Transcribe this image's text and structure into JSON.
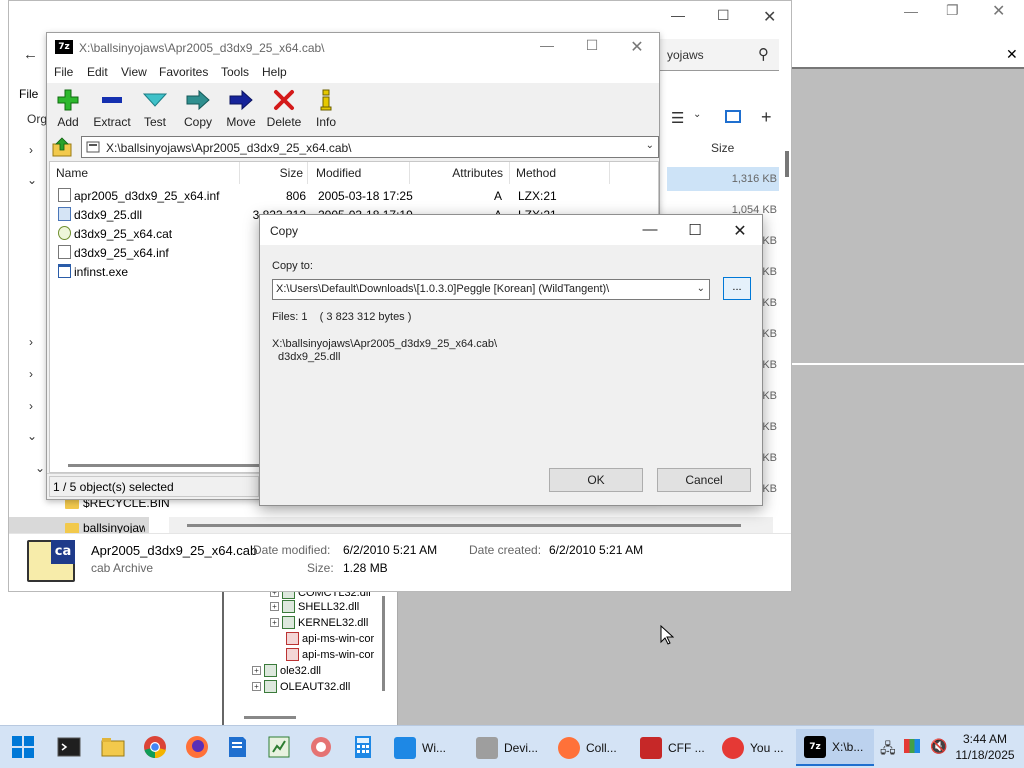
{
  "explorer": {
    "file_menu": "File",
    "org_label": "Org",
    "search_placeholder": "yojaws",
    "size_header": "Size",
    "sizes": [
      "1,316 KB",
      "1,054 KB",
      "KB",
      "KB",
      "KB",
      "KB",
      "KB",
      "KB",
      "KB",
      "KB",
      "KB"
    ],
    "tree_folders": [
      "$RECYCLE.BIN",
      "ballsinyojaws"
    ],
    "details": {
      "name": "Apr2005_d3dx9_25_x64.cab",
      "type": "cab Archive",
      "date_modified_label": "Date modified:",
      "date_modified": "6/2/2010 5:21 AM",
      "date_created_label": "Date created:",
      "date_created": "6/2/2010 5:21 AM",
      "size_label": "Size:",
      "size": "1.28 MB"
    }
  },
  "tree": {
    "items": [
      "COMCTL32.dll",
      "SHELL32.dll",
      "KERNEL32.dll",
      "api-ms-win-cor",
      "api-ms-win-cor",
      "ole32.dll",
      "OLEAUT32.dll"
    ]
  },
  "sevenzip": {
    "title": "X:\\ballsinyojaws\\Apr2005_d3dx9_25_x64.cab\\",
    "menu": [
      "File",
      "Edit",
      "View",
      "Favorites",
      "Tools",
      "Help"
    ],
    "toolbar": [
      "Add",
      "Extract",
      "Test",
      "Copy",
      "Move",
      "Delete",
      "Info"
    ],
    "address": "X:\\ballsinyojaws\\Apr2005_d3dx9_25_x64.cab\\",
    "columns": [
      "Name",
      "Size",
      "Modified",
      "Attributes",
      "Method"
    ],
    "files": [
      {
        "name": "apr2005_d3dx9_25_x64.inf",
        "size": "806",
        "modified": "2005-03-18 17:25",
        "attr": "A",
        "method": "LZX:21"
      },
      {
        "name": "d3dx9_25.dll",
        "size": "3 823 312",
        "modified": "2005-03-18 17:19",
        "attr": "A",
        "method": "LZX:21"
      },
      {
        "name": "d3dx9_25_x64.cat",
        "size": "",
        "modified": "",
        "attr": "",
        "method": ""
      },
      {
        "name": "d3dx9_25_x64.inf",
        "size": "",
        "modified": "",
        "attr": "",
        "method": ""
      },
      {
        "name": "infinst.exe",
        "size": "",
        "modified": "",
        "attr": "",
        "method": ""
      }
    ],
    "status": "1 / 5 object(s) selected"
  },
  "copy_dialog": {
    "title": "Copy",
    "copy_to_label": "Copy to:",
    "destination": "X:\\Users\\Default\\Downloads\\[1.0.3.0]Peggle [Korean] (WildTangent)\\",
    "browse_label": "...",
    "files_info": "Files: 1    ( 3 823 312 bytes )",
    "source_path": "X:\\ballsinyojaws\\Apr2005_d3dx9_25_x64.cab\\",
    "source_file": "d3dx9_25.dll",
    "ok_label": "OK",
    "cancel_label": "Cancel"
  },
  "taskbar": {
    "tasks": [
      "Wi...",
      "Devi...",
      "Coll...",
      "CFF ...",
      "You ...",
      "X:\\b..."
    ],
    "time": "3:44 AM",
    "date": "11/18/2025"
  },
  "colors": {
    "accent": "#0078d7",
    "taskbar": "#d4e3f5",
    "selection": "#cde3f7"
  }
}
